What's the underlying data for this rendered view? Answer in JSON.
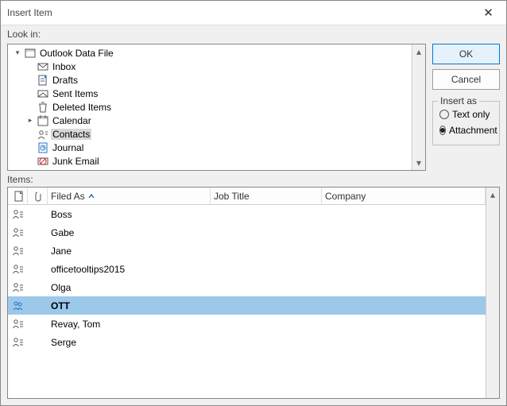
{
  "window": {
    "title": "Insert Item"
  },
  "labels": {
    "look_in": "Look in:",
    "items": "Items:"
  },
  "buttons": {
    "ok": "OK",
    "cancel": "Cancel"
  },
  "insert_as": {
    "legend": "Insert as",
    "text_only": "Text only",
    "attachment": "Attachment",
    "selected": "attachment"
  },
  "tree": [
    {
      "label": "Outlook Data File",
      "depth": 0,
      "expander": "down",
      "icon": "datafile",
      "selected": false
    },
    {
      "label": "Inbox",
      "depth": 1,
      "expander": "",
      "icon": "inbox",
      "selected": false
    },
    {
      "label": "Drafts",
      "depth": 1,
      "expander": "",
      "icon": "drafts",
      "selected": false
    },
    {
      "label": "Sent Items",
      "depth": 1,
      "expander": "",
      "icon": "sent",
      "selected": false
    },
    {
      "label": "Deleted Items",
      "depth": 1,
      "expander": "",
      "icon": "deleted",
      "selected": false
    },
    {
      "label": "Calendar",
      "depth": 1,
      "expander": "right",
      "icon": "calendar",
      "selected": false
    },
    {
      "label": "Contacts",
      "depth": 1,
      "expander": "",
      "icon": "contacts",
      "selected": true
    },
    {
      "label": "Journal",
      "depth": 1,
      "expander": "",
      "icon": "journal",
      "selected": false
    },
    {
      "label": "Junk Email",
      "depth": 1,
      "expander": "",
      "icon": "junk",
      "selected": false
    }
  ],
  "grid": {
    "headers": {
      "filed_as": "Filed As",
      "job_title": "Job Title",
      "company": "Company"
    },
    "rows": [
      {
        "icon": "contact",
        "filed_as": "Boss",
        "selected": false
      },
      {
        "icon": "contact",
        "filed_as": "Gabe",
        "selected": false
      },
      {
        "icon": "contact",
        "filed_as": "Jane",
        "selected": false
      },
      {
        "icon": "contact",
        "filed_as": "officetooltips2015",
        "selected": false
      },
      {
        "icon": "contact",
        "filed_as": "Olga",
        "selected": false
      },
      {
        "icon": "distlist",
        "filed_as": "OTT",
        "selected": true
      },
      {
        "icon": "contact",
        "filed_as": "Revay, Tom",
        "selected": false
      },
      {
        "icon": "contact",
        "filed_as": "Serge",
        "selected": false
      }
    ]
  }
}
